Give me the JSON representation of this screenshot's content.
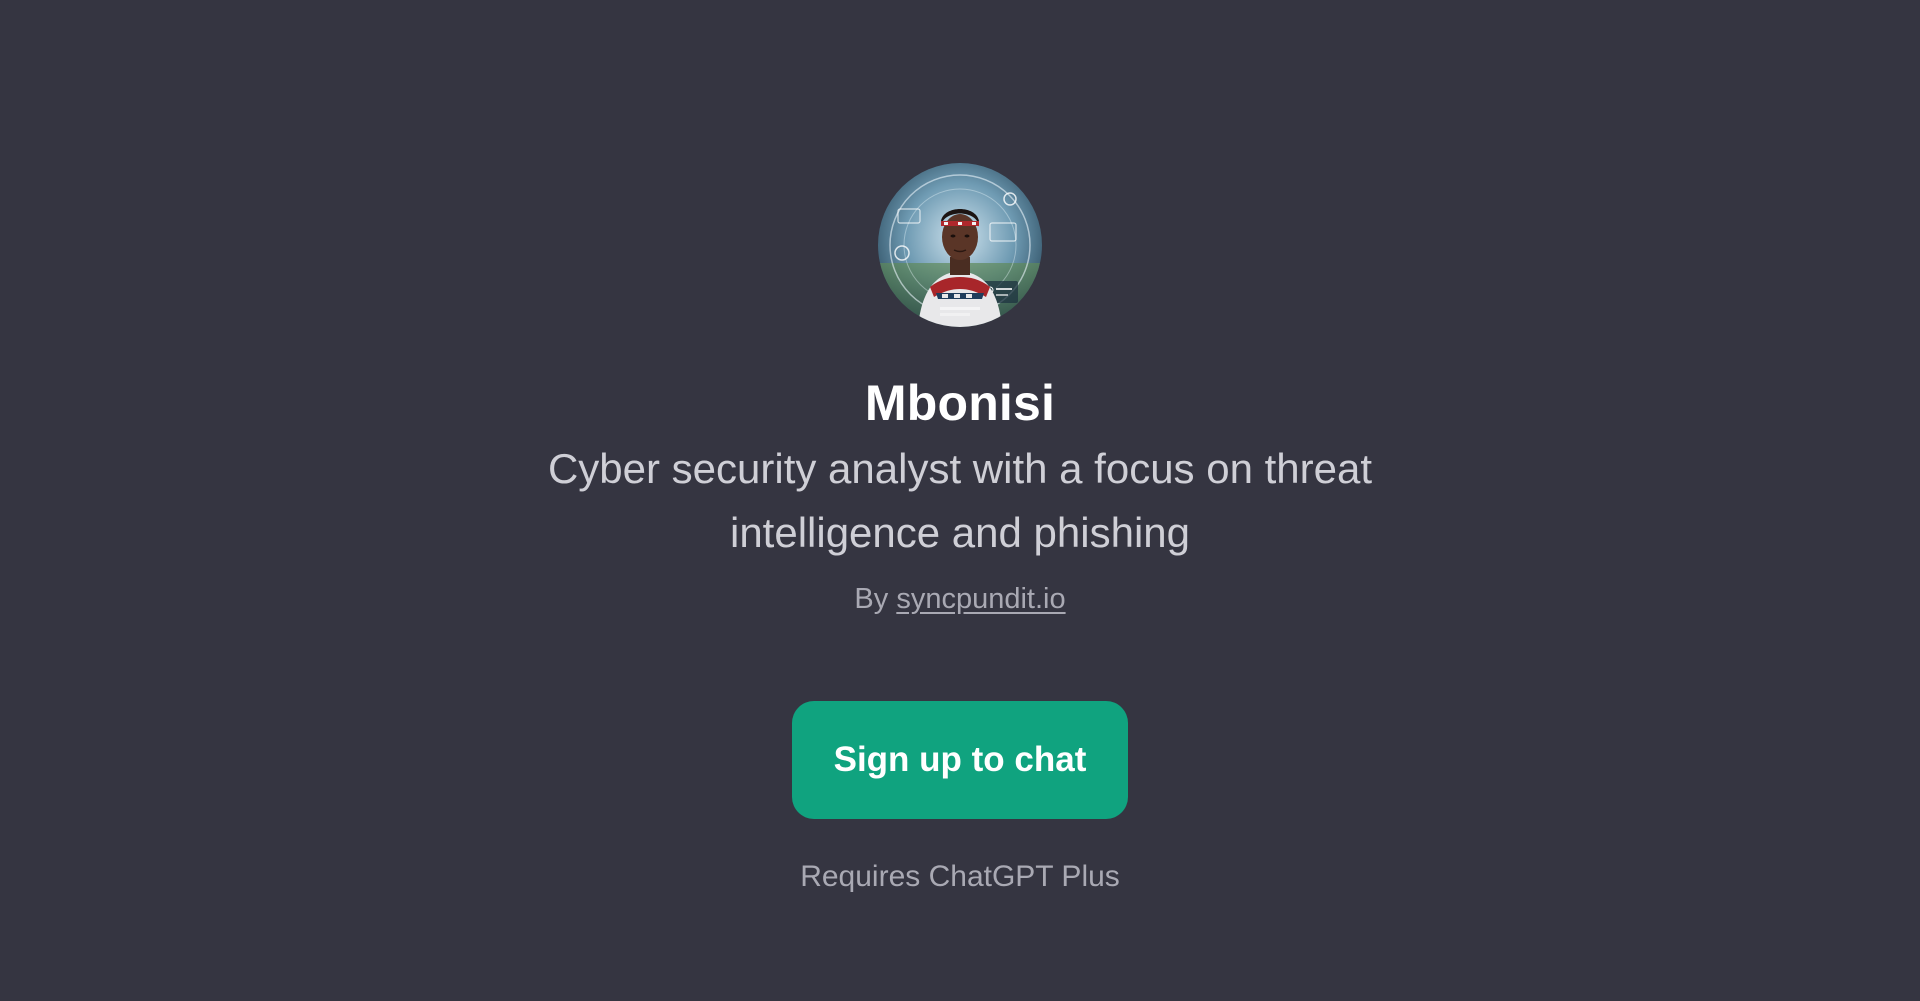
{
  "gpt": {
    "name": "Mbonisi",
    "description": "Cyber security analyst with a focus on threat intelligence and phishing",
    "byline_prefix": "By",
    "author": "syncpundit.io",
    "avatar_icon": "avatar-portrait-cyber-analyst"
  },
  "cta": {
    "label": "Sign up to chat",
    "color": "#10a37f"
  },
  "note": "Requires ChatGPT Plus",
  "theme": {
    "background": "#353541",
    "title_color": "#ffffff",
    "text_color": "#cfcfd6",
    "muted_color": "#a9a9b3"
  }
}
